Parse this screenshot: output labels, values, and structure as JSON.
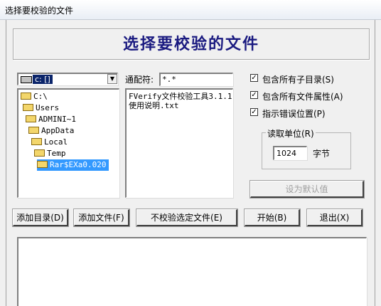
{
  "window": {
    "title": "选择要校验的文件"
  },
  "banner": {
    "title": "选择要校验的文件"
  },
  "drive": {
    "selected": "c: []"
  },
  "tree": {
    "items": [
      {
        "label": "C:\\"
      },
      {
        "label": "Users"
      },
      {
        "label": "ADMINI~1"
      },
      {
        "label": "AppData"
      },
      {
        "label": "Local"
      },
      {
        "label": "Temp"
      },
      {
        "label": "Rar$EXa0.020",
        "selected": true
      }
    ]
  },
  "pattern": {
    "label": "通配符:",
    "value": "*.*"
  },
  "files": {
    "items": [
      "FVerify文件校验工具3.1.1.",
      "使用说明.txt"
    ]
  },
  "options": [
    {
      "label": "包含所有子目录(S)",
      "checked": true
    },
    {
      "label": "包含所有文件属性(A)",
      "checked": true
    },
    {
      "label": "指示错误位置(P)",
      "checked": true
    }
  ],
  "read_unit": {
    "group_label": "读取单位(R)",
    "value": "1024",
    "unit": "字节"
  },
  "buttons": {
    "set_default": "设为默认值",
    "add_dir": "添加目录(D)",
    "add_file": "添加文件(F)",
    "exclude": "不校验选定文件(E)",
    "start": "开始(B)",
    "exit": "退出(X)"
  },
  "colors": {
    "banner_text": "#1a1a80",
    "selection": "#3399ff",
    "drive_highlight": "#0a246a"
  }
}
